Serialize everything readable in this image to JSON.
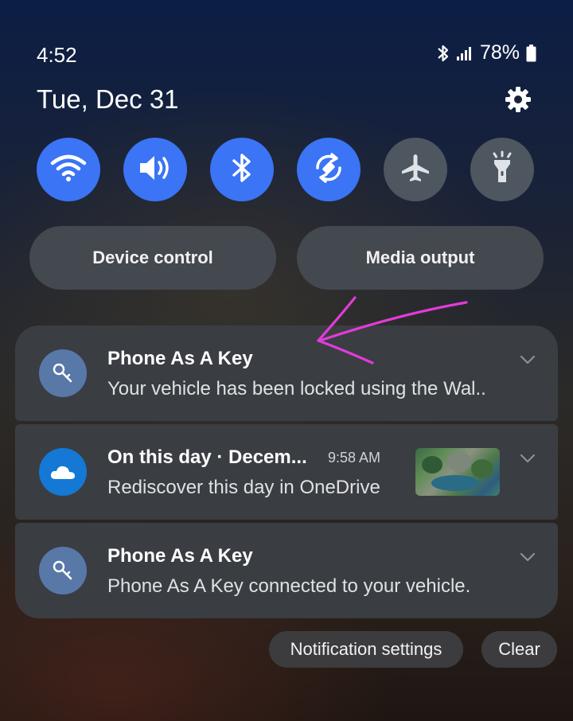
{
  "status_bar": {
    "time": "4:52",
    "battery": "78%",
    "icons": [
      "bluetooth-icon",
      "signal-icon",
      "battery-icon"
    ]
  },
  "header": {
    "date": "Tue, Dec 31",
    "settings_icon": "gear-icon"
  },
  "quick_toggles": [
    {
      "name": "wifi",
      "icon": "wifi-icon",
      "state": "on"
    },
    {
      "name": "sound",
      "icon": "speaker-icon",
      "state": "on"
    },
    {
      "name": "bluetooth",
      "icon": "bluetooth-icon",
      "state": "on"
    },
    {
      "name": "auto-rotate",
      "icon": "rotate-icon",
      "state": "on"
    },
    {
      "name": "airplane-mode",
      "icon": "airplane-icon",
      "state": "off"
    },
    {
      "name": "flashlight",
      "icon": "flashlight-icon",
      "state": "off"
    }
  ],
  "controls": {
    "device_control": "Device control",
    "media_output": "Media output"
  },
  "notifications": [
    {
      "app_icon": "key-icon",
      "title": "Phone As A Key",
      "body": "Your vehicle has been locked using the Wal.."
    },
    {
      "app_icon": "onedrive-cloud-icon",
      "title": "On this day · Decem...",
      "timestamp": "9:58 AM",
      "body": "Rediscover this day in OneDrive",
      "thumbnail": "photo-thumbnail"
    },
    {
      "app_icon": "key-icon",
      "title": "Phone As A Key",
      "body": "Phone As A Key connected to your vehicle."
    }
  ],
  "footer": {
    "notification_settings": "Notification settings",
    "clear": "Clear"
  },
  "colors": {
    "toggle_on": "#3b74f4",
    "toggle_off": "#4e5660",
    "annotation_arrow": "#e23bd8"
  }
}
